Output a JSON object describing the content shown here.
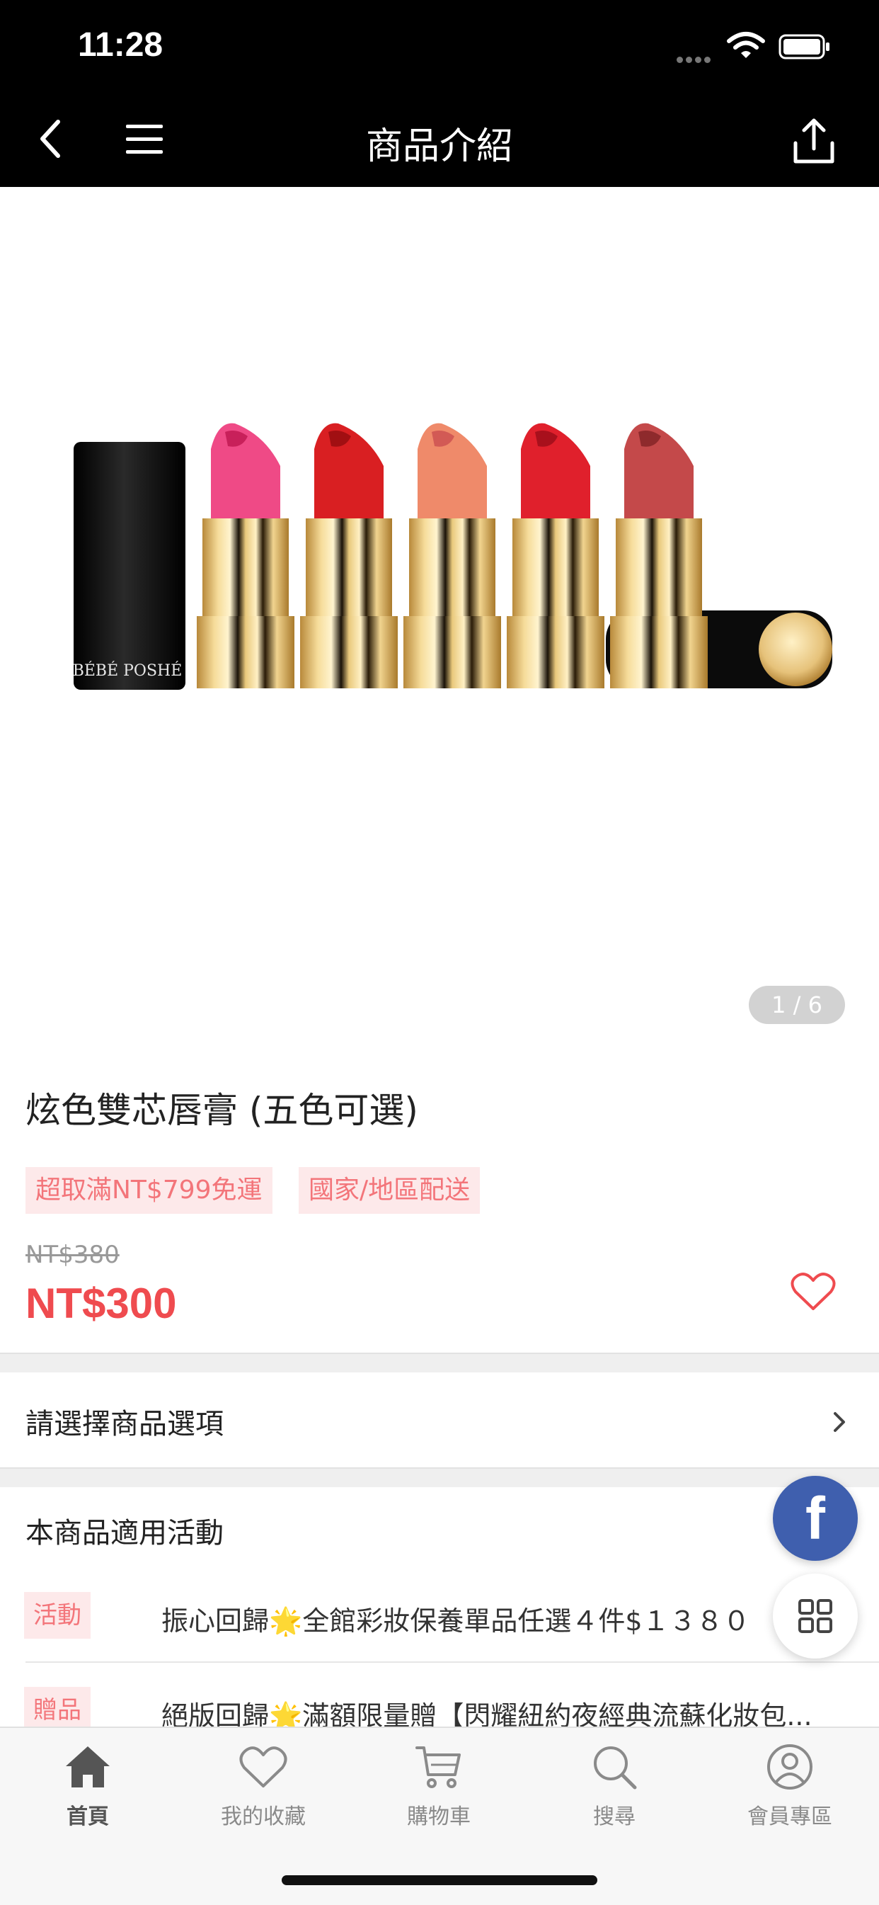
{
  "status_bar": {
    "time": "11:28"
  },
  "nav": {
    "title": "商品介紹"
  },
  "product": {
    "image_counter": "1 / 6",
    "image_brand": "BÉBÉ POSHÉ",
    "title": "炫色雙芯唇膏 (五色可選)",
    "tags": [
      "超取滿NT$799免運",
      "國家/地區配送"
    ],
    "price_original": "NT$380",
    "price_current": "NT$300"
  },
  "options": {
    "label": "請選擇商品選項"
  },
  "activities": {
    "header": "本商品適用活動",
    "items": [
      {
        "badge": "活動",
        "text": "振心回歸🌟全館彩妝保養單品任選４件$１３８０"
      },
      {
        "badge": "贈品",
        "text": "絕版回歸🌟滿額限量贈【閃耀紐約夜經典流蘇化妝包..."
      }
    ]
  },
  "floating": {
    "facebook_glyph": "f"
  },
  "tabbar": {
    "items": [
      {
        "label": "首頁",
        "icon": "home-icon"
      },
      {
        "label": "我的收藏",
        "icon": "heart-icon"
      },
      {
        "label": "購物車",
        "icon": "cart-icon"
      },
      {
        "label": "搜尋",
        "icon": "search-icon"
      },
      {
        "label": "會員專區",
        "icon": "user-icon"
      }
    ]
  },
  "colors": {
    "accent": "#ef4b4f",
    "tag_bg": "#fde9ea",
    "tag_text": "#f3757a",
    "facebook": "#3f5fae"
  }
}
